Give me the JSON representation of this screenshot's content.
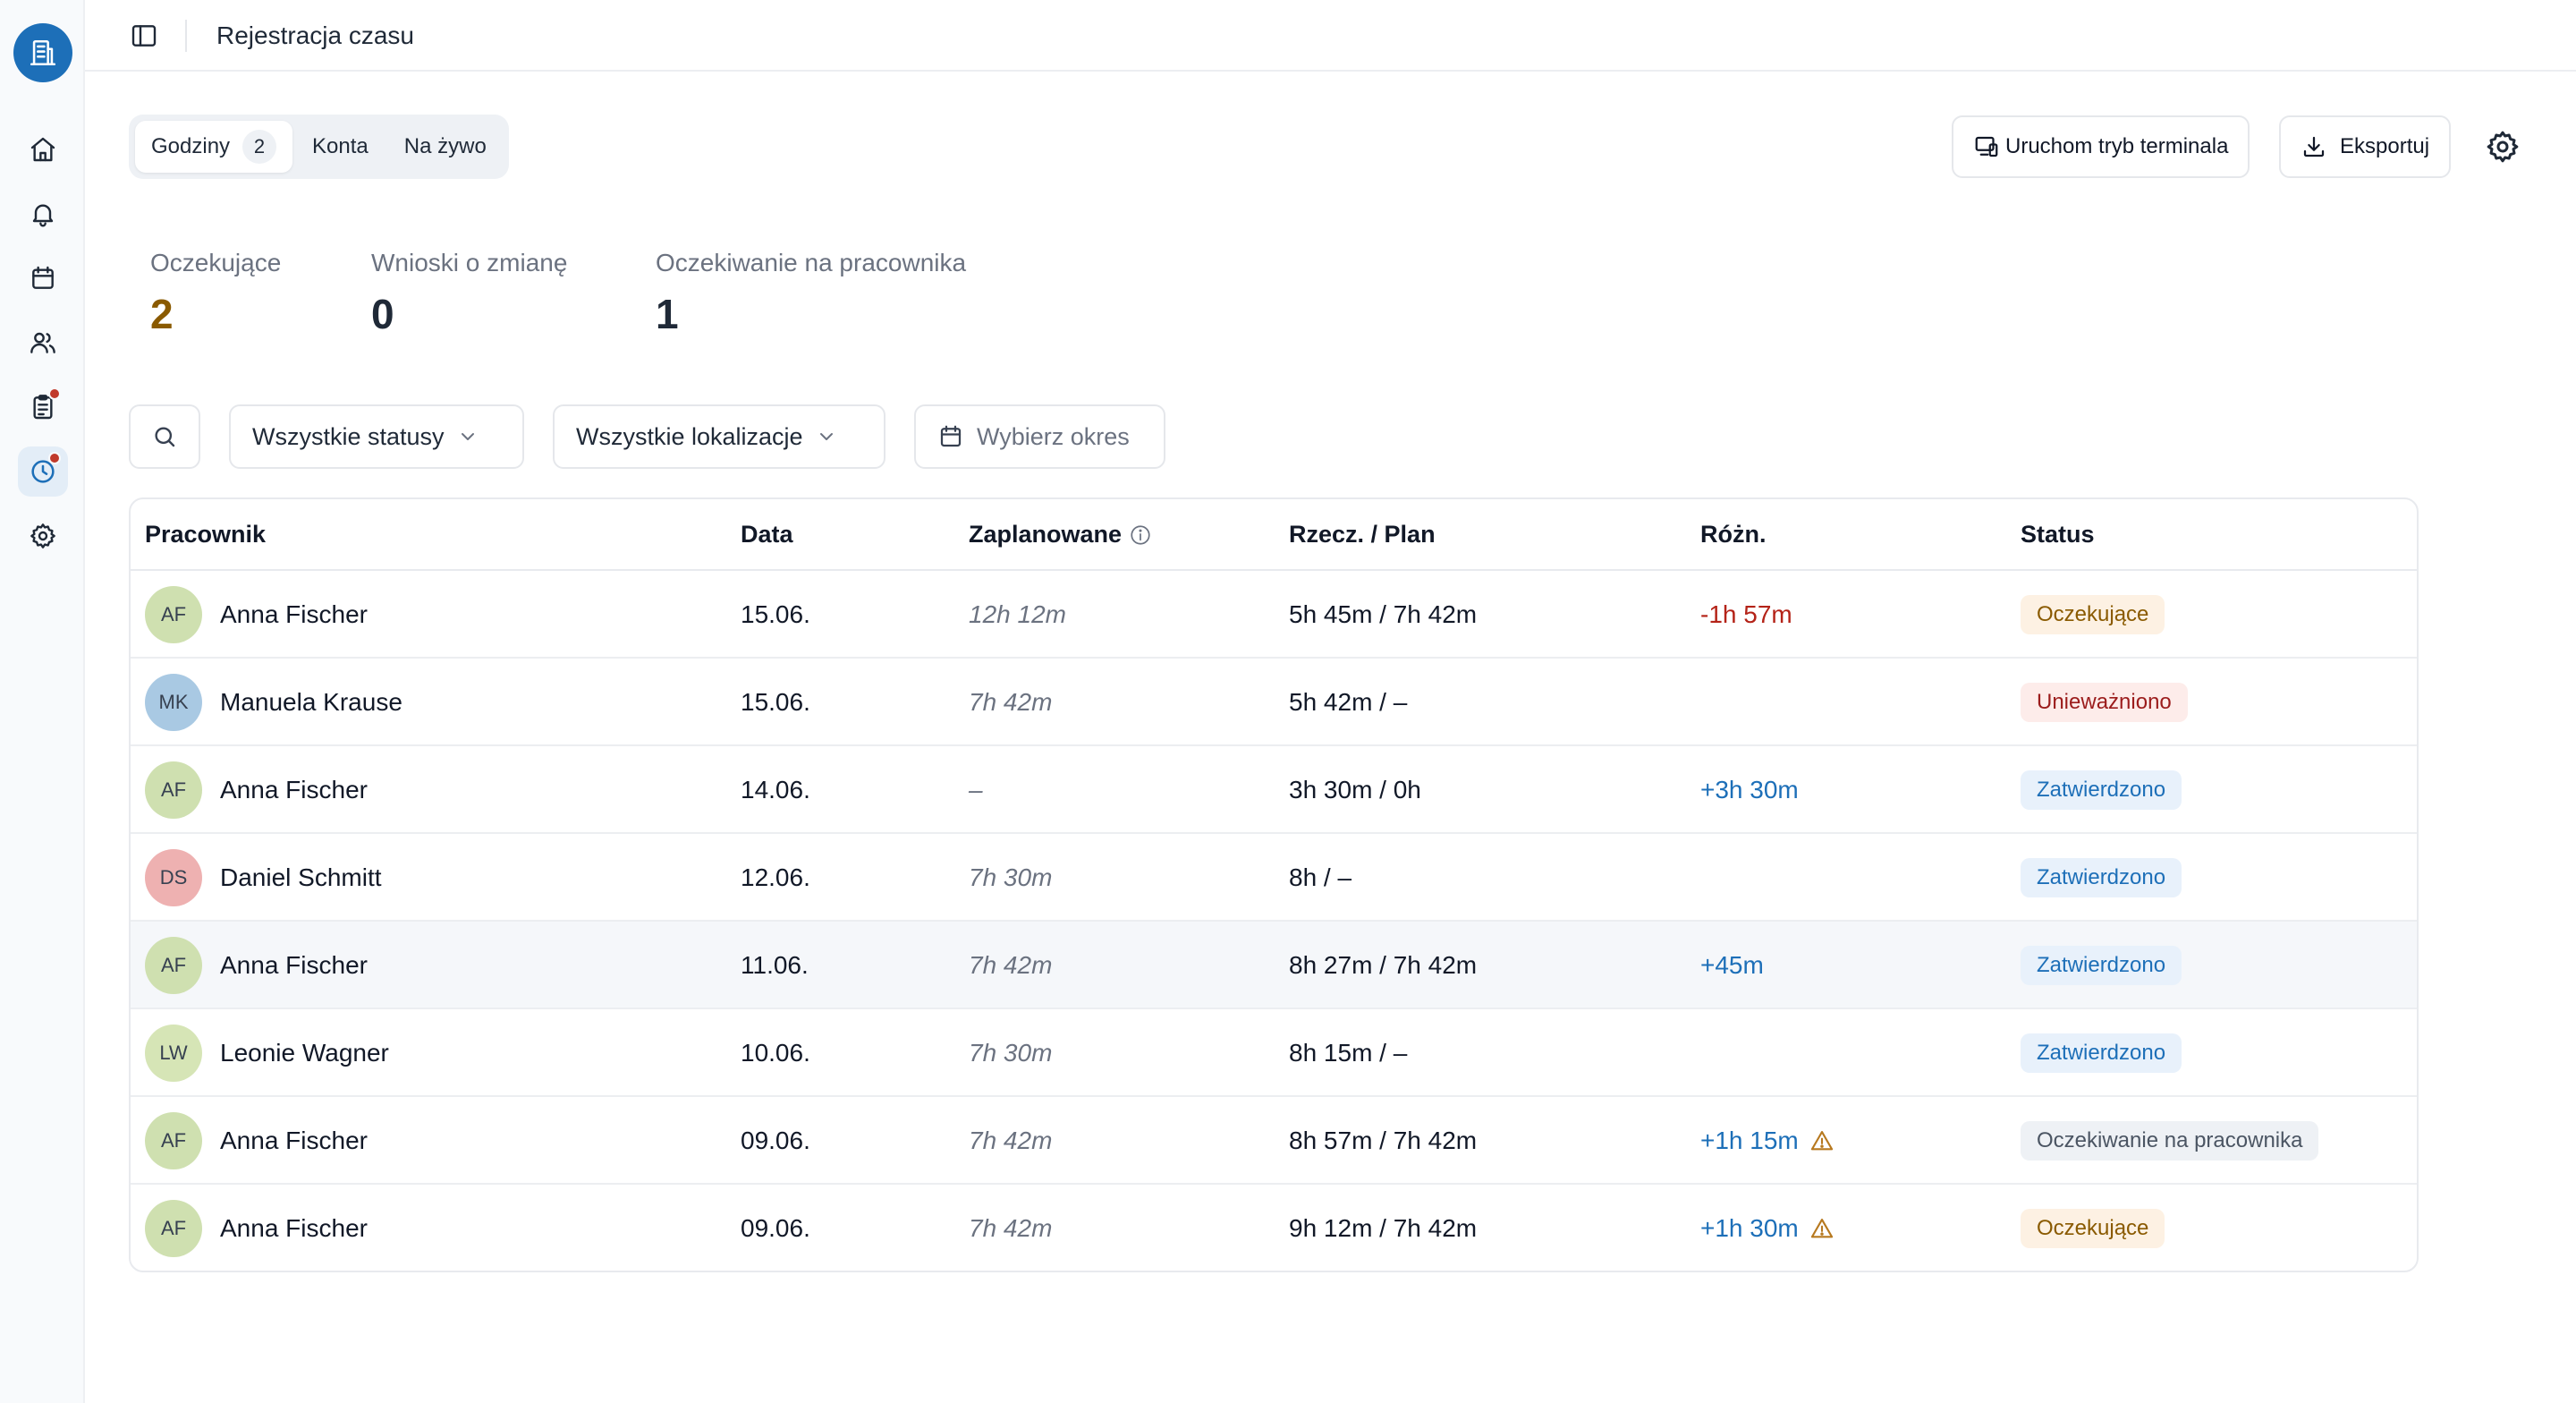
{
  "app": {
    "page_title": "Rejestracja czasu"
  },
  "sidebar": {
    "items": [
      {
        "name": "home-icon",
        "has_dot": false,
        "active": false
      },
      {
        "name": "bell-icon",
        "has_dot": false,
        "active": false
      },
      {
        "name": "calendar-icon",
        "has_dot": false,
        "active": false
      },
      {
        "name": "users-icon",
        "has_dot": false,
        "active": false
      },
      {
        "name": "clipboard-icon",
        "has_dot": true,
        "active": false
      },
      {
        "name": "clock-icon",
        "has_dot": true,
        "active": true
      },
      {
        "name": "settings-icon",
        "has_dot": false,
        "active": false
      }
    ]
  },
  "tabs": [
    {
      "label": "Godziny",
      "count": "2",
      "active": true
    },
    {
      "label": "Konta",
      "active": false
    },
    {
      "label": "Na żywo",
      "active": false
    }
  ],
  "actions": {
    "terminal_label": "Uruchom tryb terminala",
    "export_label": "Eksportuj"
  },
  "stats": [
    {
      "label": "Oczekujące",
      "value": "2"
    },
    {
      "label": "Wnioski o zmianę",
      "value": "0"
    },
    {
      "label": "Oczekiwanie na pracownika",
      "value": "1"
    }
  ],
  "filters": {
    "status_selected": "Wszystkie statusy",
    "location_selected": "Wszystkie lokalizacje",
    "period_placeholder": "Wybierz okres"
  },
  "table": {
    "columns": [
      "Pracownik",
      "Data",
      "Zaplanowane",
      "Rzecz. / Plan",
      "Różn.",
      "Status"
    ],
    "rows": [
      {
        "initials": "AF",
        "avatar_color": "#cfe0b0",
        "name": "Anna Fischer",
        "date": "15.06.",
        "planned": "12h 12m",
        "actual_plan": "5h 45m / 7h 42m",
        "diff": "-1h 57m",
        "diff_type": "neg",
        "warning": false,
        "status": "Oczekujące",
        "status_type": "pending"
      },
      {
        "initials": "MK",
        "avatar_color": "#a9c9e3",
        "name": "Manuela Krause",
        "date": "15.06.",
        "planned": "7h 42m",
        "actual_plan": "5h 42m / –",
        "diff": "",
        "diff_type": "none",
        "warning": false,
        "status": "Unieważniono",
        "status_type": "voided"
      },
      {
        "initials": "AF",
        "avatar_color": "#cfe0b0",
        "name": "Anna Fischer",
        "date": "14.06.",
        "planned": "–",
        "actual_plan": "3h 30m / 0h",
        "diff": "+3h 30m",
        "diff_type": "pos",
        "warning": false,
        "status": "Zatwierdzono",
        "status_type": "approved"
      },
      {
        "initials": "DS",
        "avatar_color": "#eeb1b1",
        "name": "Daniel Schmitt",
        "date": "12.06.",
        "planned": "7h 30m",
        "actual_plan": "8h / –",
        "diff": "",
        "diff_type": "none",
        "warning": false,
        "status": "Zatwierdzono",
        "status_type": "approved"
      },
      {
        "initials": "AF",
        "avatar_color": "#cfe0b0",
        "name": "Anna Fischer",
        "date": "11.06.",
        "planned": "7h 42m",
        "actual_plan": "8h 27m / 7h 42m",
        "diff": "+45m",
        "diff_type": "pos",
        "warning": false,
        "status": "Zatwierdzono",
        "status_type": "approved"
      },
      {
        "initials": "LW",
        "avatar_color": "#d6e5b6",
        "name": "Leonie Wagner",
        "date": "10.06.",
        "planned": "7h 30m",
        "actual_plan": "8h 15m / –",
        "diff": "",
        "diff_type": "none",
        "warning": false,
        "status": "Zatwierdzono",
        "status_type": "approved"
      },
      {
        "initials": "AF",
        "avatar_color": "#cfe0b0",
        "name": "Anna Fischer",
        "date": "09.06.",
        "planned": "7h 42m",
        "actual_plan": "8h 57m / 7h 42m",
        "diff": "+1h 15m",
        "diff_type": "pos",
        "warning": true,
        "status": "Oczekiwanie na pracownika",
        "status_type": "waiting"
      },
      {
        "initials": "AF",
        "avatar_color": "#cfe0b0",
        "name": "Anna Fischer",
        "date": "09.06.",
        "planned": "7h 42m",
        "actual_plan": "9h 12m / 7h 42m",
        "diff": "+1h 30m",
        "diff_type": "pos",
        "warning": true,
        "status": "Oczekujące",
        "status_type": "pending"
      }
    ]
  }
}
